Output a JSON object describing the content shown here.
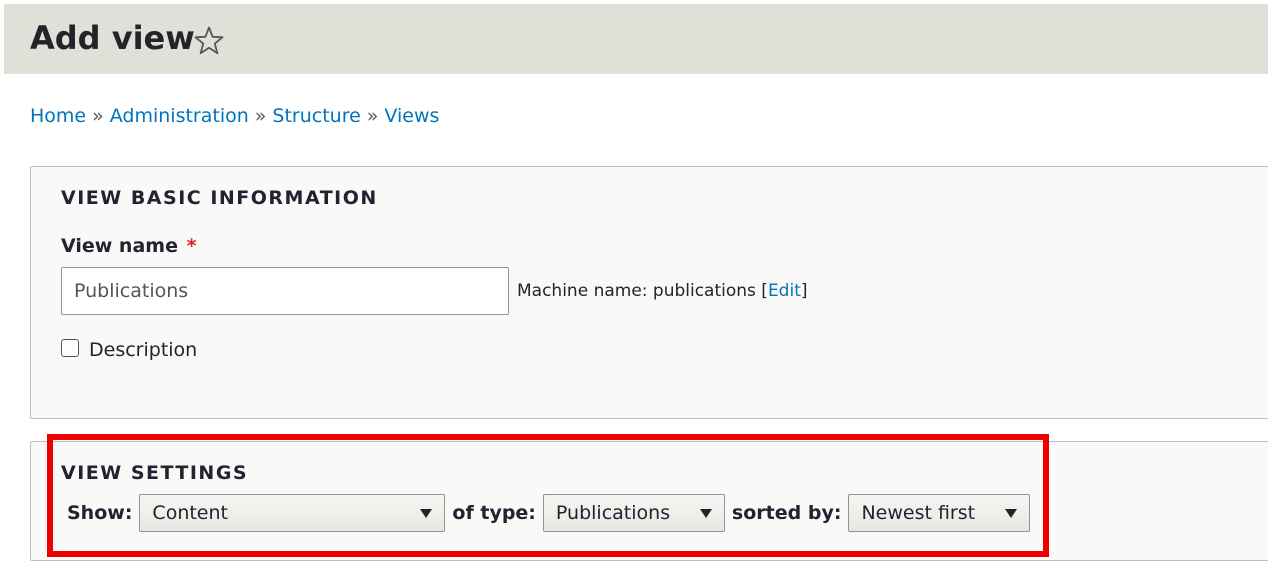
{
  "header": {
    "title": "Add view"
  },
  "breadcrumb": [
    "Home",
    "Administration",
    "Structure",
    "Views"
  ],
  "breadcrumb_separator": "»",
  "basic_info": {
    "legend": "VIEW BASIC INFORMATION",
    "view_name_label": "View name",
    "required_mark": "*",
    "view_name_value": "Publications",
    "machine_name_prefix": "Machine name: publications [",
    "machine_name_edit": "Edit",
    "machine_name_suffix": "]",
    "description_label": "Description",
    "description_checked": false
  },
  "settings": {
    "legend": "VIEW SETTINGS",
    "show_label": "Show:",
    "show_value": "Content",
    "type_label": "of type:",
    "type_value": "Publications",
    "sort_label": "sorted by:",
    "sort_value": "Newest first"
  },
  "colors": {
    "header_bg": "#e0e0d8",
    "link": "#0074bd",
    "required": "#dc2323",
    "highlight": "#ee0000",
    "fieldset_bg": "#f9f9f7"
  },
  "icons": {
    "favorite": "star-outline-icon",
    "dropdown": "triangle-down-icon"
  }
}
